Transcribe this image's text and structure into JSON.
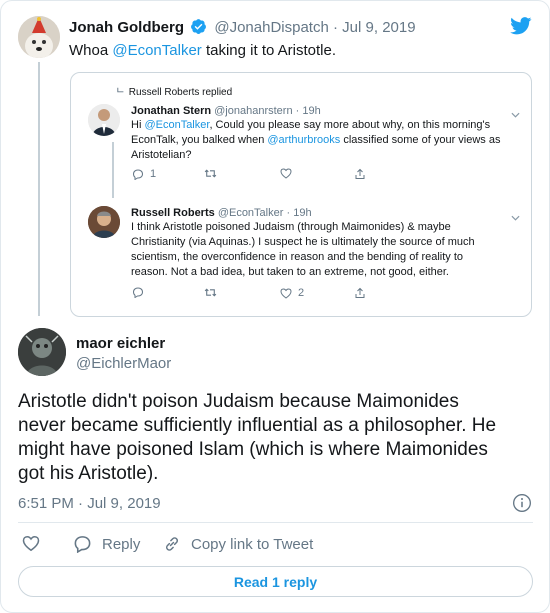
{
  "colors": {
    "accent": "#1da1f2",
    "link": "#1b95e0",
    "muted": "#657786",
    "text": "#14171a"
  },
  "parent_tweet": {
    "author_name": "Jonah Goldberg",
    "handle": "@JonahDispatch",
    "separator": "·",
    "date": "Jul 9, 2019",
    "text_before": "Whoa ",
    "mention": "@EconTalker",
    "text_after": " taking it to Aristotle.",
    "verified_icon": "verified-badge-icon",
    "avatar_icon": "jonah-avatar"
  },
  "quoted_thread": {
    "replied_note": "Russell Roberts replied",
    "first": {
      "name": "Jonathan Stern",
      "handle": "@jonahanrstern",
      "separator": "·",
      "time": "19h",
      "lines": [
        {
          "pre": "Hi ",
          "mention": "@EconTalker",
          "post": ", Could you please say more about why, on this morning's"
        },
        {
          "pre": "EconTalk, you balked when ",
          "mention": "@arthurbrooks",
          "post": " classified some of your views as"
        },
        {
          "pre": "Aristotelian?",
          "mention": "",
          "post": ""
        }
      ],
      "reply_count": "1",
      "retweet_count": "",
      "like_count": ""
    },
    "second": {
      "name": "Russell Roberts",
      "handle": "@EconTalker",
      "separator": "·",
      "time": "19h",
      "lines": [
        "I think Aristotle poisoned Judaism (through Maimonides) & maybe",
        "Christianity (via Aquinas.) I suspect he is ultimately the source of much",
        "scientism, the overconfidence in reason and the bending of reality to",
        "reason. Not a bad idea, but taken to an extreme, not good, either."
      ],
      "reply_count": "",
      "retweet_count": "",
      "like_count": "2"
    }
  },
  "main_tweet": {
    "author_name": "maor eichler",
    "handle": "@EichlerMaor",
    "text_lines": [
      "Aristotle didn't poison Judaism because Maimonides",
      "never became sufficiently influential as a philosopher. He",
      "might have poisoned Islam (which is where Maimonides",
      "got his Aristotle)."
    ],
    "time": "6:51 PM",
    "separator": "·",
    "date": "Jul 9, 2019"
  },
  "actions": {
    "reply_label": "Reply",
    "copy_link_label": "Copy link to Tweet",
    "read_replies_label": "Read 1 reply"
  }
}
